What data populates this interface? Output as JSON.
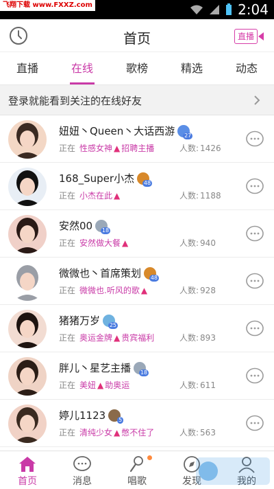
{
  "status_bar": {
    "time": "2:04",
    "watermark": "飞翔下载 www.FXXZ.com"
  },
  "header": {
    "title": "首页",
    "live_label": "直播"
  },
  "tabs": [
    {
      "label": "直播"
    },
    {
      "label": "在线"
    },
    {
      "label": "歌榜"
    },
    {
      "label": "精选"
    },
    {
      "label": "动态"
    }
  ],
  "banner": {
    "text": "登录就能看到关注的在线好友"
  },
  "rows": [
    {
      "name": "妞妞丶Queen丶大话西游",
      "badge": "27",
      "status": "正在",
      "show_a": "性感女神",
      "show_b": "招聘主播",
      "count_label": "人数:",
      "count": "1426",
      "badge_color": "#5a8ee6"
    },
    {
      "name": "168_Super小杰",
      "badge": "48",
      "status": "正在",
      "show_a": "小杰在此",
      "show_b": "",
      "count_label": "人数:",
      "count": "1188",
      "badge_color": "#d8892a"
    },
    {
      "name": "安然00",
      "badge": "18",
      "status": "正在",
      "show_a": "安然做大餐",
      "show_b": "",
      "count_label": "人数:",
      "count": "940",
      "badge_color": "#9aa8b8"
    },
    {
      "name": "微微也丶首席策划",
      "badge": "48",
      "status": "正在",
      "show_a": "微微也.听风的歌",
      "show_b": "",
      "count_label": "人数:",
      "count": "928",
      "badge_color": "#d8892a"
    },
    {
      "name": "猪猪万岁",
      "badge": "25",
      "status": "正在",
      "show_a": "奥运金牌",
      "show_b": "贵宾福利",
      "count_label": "人数:",
      "count": "893",
      "badge_color": "#6fb2e0"
    },
    {
      "name": "胖儿丶星艺主播",
      "badge": "18",
      "status": "正在",
      "show_a": "美妞",
      "show_b": "助奥运",
      "count_label": "人数:",
      "count": "611",
      "badge_color": "#9aa8b8"
    },
    {
      "name": "婷儿1123",
      "badge": "5",
      "status": "正在",
      "show_a": "清纯少女",
      "show_b": "憋不住了",
      "count_label": "人数:",
      "count": "563",
      "badge_color": "#8a6a4a"
    }
  ],
  "bottom_nav": [
    {
      "label": "首页",
      "icon": "home-icon"
    },
    {
      "label": "消息",
      "icon": "message-icon"
    },
    {
      "label": "唱歌",
      "icon": "microphone-icon"
    },
    {
      "label": "发现",
      "icon": "discover-icon"
    },
    {
      "label": "我的",
      "icon": "profile-icon"
    }
  ],
  "bottom_watermark": "飞翔下载 www.FXXZ.com",
  "colors": {
    "accent": "#c93aa7",
    "fire": "#e0307a"
  }
}
